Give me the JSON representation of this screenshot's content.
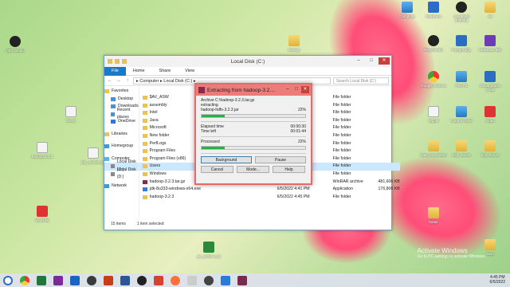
{
  "desktop": {
    "icons_left": [
      {
        "label": "OBS Studio"
      },
      {
        "label": "file.txt"
      },
      {
        "label": "hadoop-3.2.3"
      },
      {
        "label": "WinRAR"
      }
    ],
    "icons_middle": [
      {
        "label": "hadoop"
      },
      {
        "label": "jdk_archive.zip"
      },
      {
        "label": "jar_archive.zip"
      }
    ],
    "icons_right": [
      {
        "label": "Computer"
      },
      {
        "label": "NetBeans"
      },
      {
        "label": "download shortcut"
      },
      {
        "label": "sb"
      },
      {
        "label": "Google Chrome"
      },
      {
        "label": "Google Chrome"
      },
      {
        "label": "This PC"
      },
      {
        "label": "Visual Studio Code"
      },
      {
        "label": "Signal"
      },
      {
        "label": "Control Panel"
      },
      {
        "label": "Video"
      },
      {
        "label": "Brave"
      },
      {
        "label": "Data preparation"
      },
      {
        "label": "SQL Server"
      },
      {
        "label": "SQL Server"
      },
      {
        "label": "folder"
      },
      {
        "label": "Recycle Bin"
      },
      {
        "label": "PostgreSQL"
      },
      {
        "label": "NetBeans IDE"
      },
      {
        "label": "Recycle Bin"
      },
      {
        "label": "Java"
      }
    ],
    "activate_line1": "Activate Windows",
    "activate_line2": "Go to PC settings to activate Windows."
  },
  "explorer": {
    "title": "Local Disk (C:)",
    "ribbon_tabs": [
      "File",
      "Home",
      "Share",
      "View"
    ],
    "address": "▸ Computer ▸ Local Disk (C:) ▸",
    "search_placeholder": "Search Local Disk (C:)",
    "nav": [
      {
        "label": "Favorites"
      },
      {
        "label": "Desktop"
      },
      {
        "label": "Downloads"
      },
      {
        "label": "Recent places"
      },
      {
        "label": "OneDrive"
      },
      {
        "label": "Libraries"
      },
      {
        "label": "Homegroup"
      },
      {
        "label": "Computer"
      },
      {
        "label": "Local Disk (C:)"
      },
      {
        "label": "Local Disk (D:)"
      },
      {
        "label": "Network"
      }
    ],
    "files": [
      {
        "name": "$AV_ASW",
        "date": "",
        "type": "File folder",
        "size": ""
      },
      {
        "name": "assembly",
        "date": "",
        "type": "File folder",
        "size": ""
      },
      {
        "name": "Intel",
        "date": "",
        "type": "File folder",
        "size": ""
      },
      {
        "name": "Java",
        "date": "",
        "type": "File folder",
        "size": ""
      },
      {
        "name": "Microsoft",
        "date": "",
        "type": "File folder",
        "size": ""
      },
      {
        "name": "New folder",
        "date": "",
        "type": "File folder",
        "size": ""
      },
      {
        "name": "PerfLogs",
        "date": "",
        "type": "File folder",
        "size": ""
      },
      {
        "name": "Program Files",
        "date": "",
        "type": "File folder",
        "size": ""
      },
      {
        "name": "Program Files (x86)",
        "date": "",
        "type": "File folder",
        "size": ""
      },
      {
        "name": "Users",
        "date": "",
        "type": "File folder",
        "size": ""
      },
      {
        "name": "Windows",
        "date": "6/5/2022 4:38 PM",
        "type": "File folder",
        "size": ""
      },
      {
        "name": "hadoop-3.2.3.tar.gz",
        "date": "6/5/2022 4:36 PM",
        "type": "WinRAR archive",
        "size": "481,606 KB"
      },
      {
        "name": "jdk-8u333-windows-x64.exe",
        "date": "6/5/2022 4:41 PM",
        "type": "Application",
        "size": "176,806 KB"
      },
      {
        "name": "hadoop-3.2.3",
        "date": "6/5/2022 4:45 PM",
        "type": "File folder",
        "size": ""
      }
    ],
    "status_count": "15 items",
    "status_selected": "1 item selected"
  },
  "extract_dialog": {
    "title": "Extracting from hadoop-3.2....",
    "archive_line": "Archive C:\\hadoop-3.2.3.tar.gz",
    "action": "extracting",
    "current_file": "hadoop-hdfs-3.2.3.jar",
    "file_percent": "22%",
    "file_progress": 22,
    "elapsed_label": "Elapsed time",
    "elapsed_value": "00:00:30",
    "left_label": "Time left",
    "left_value": "00:01:44",
    "processed_label": "Processed",
    "processed_percent": "22%",
    "processed_progress": 22,
    "btn_background": "Background",
    "btn_pause": "Pause",
    "btn_cancel": "Cancel",
    "btn_mode": "Mode...",
    "btn_help": "Help"
  },
  "taskbar": {
    "time": "4:45 PM",
    "date": "6/5/2022"
  }
}
